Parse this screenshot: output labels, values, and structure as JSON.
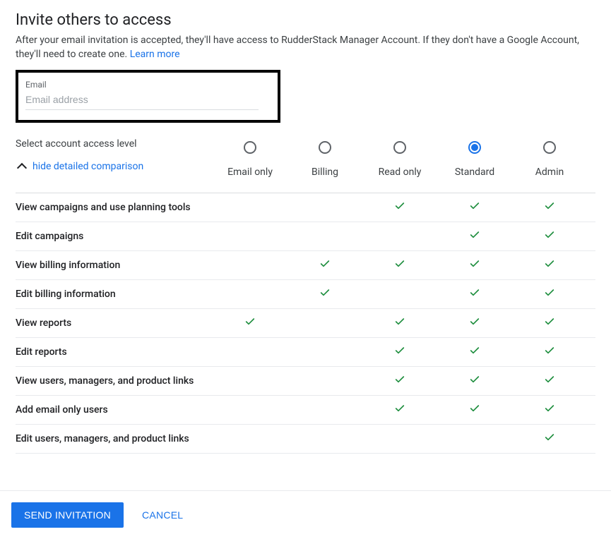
{
  "header": {
    "title": "Invite others to access",
    "subtitle_prefix": "After your email invitation is accepted, they'll have access to RudderStack Manager Account. If they don't have a Google Account, they'll need to create one. ",
    "learn_more": "Learn more"
  },
  "email": {
    "label": "Email",
    "placeholder": "Email address",
    "value": ""
  },
  "access": {
    "select_label": "Select account access level",
    "toggle_label": "hide detailed comparison",
    "levels": [
      {
        "key": "email_only",
        "label": "Email only",
        "selected": false
      },
      {
        "key": "billing",
        "label": "Billing",
        "selected": false
      },
      {
        "key": "read_only",
        "label": "Read only",
        "selected": false
      },
      {
        "key": "standard",
        "label": "Standard",
        "selected": true
      },
      {
        "key": "admin",
        "label": "Admin",
        "selected": false
      }
    ],
    "permissions": [
      {
        "label": "View campaigns and use planning tools",
        "cells": [
          false,
          false,
          true,
          true,
          true
        ]
      },
      {
        "label": "Edit campaigns",
        "cells": [
          false,
          false,
          false,
          true,
          true
        ]
      },
      {
        "label": "View billing information",
        "cells": [
          false,
          true,
          true,
          true,
          true
        ]
      },
      {
        "label": "Edit billing information",
        "cells": [
          false,
          true,
          false,
          true,
          true
        ]
      },
      {
        "label": "View reports",
        "cells": [
          true,
          false,
          true,
          true,
          true
        ]
      },
      {
        "label": "Edit reports",
        "cells": [
          false,
          false,
          true,
          true,
          true
        ]
      },
      {
        "label": "View users, managers, and product links",
        "cells": [
          false,
          false,
          true,
          true,
          true
        ]
      },
      {
        "label": "Add email only users",
        "cells": [
          false,
          false,
          true,
          true,
          true
        ]
      },
      {
        "label": "Edit users, managers, and product links",
        "cells": [
          false,
          false,
          false,
          false,
          true
        ]
      }
    ]
  },
  "footer": {
    "send": "SEND INVITATION",
    "cancel": "CANCEL"
  }
}
